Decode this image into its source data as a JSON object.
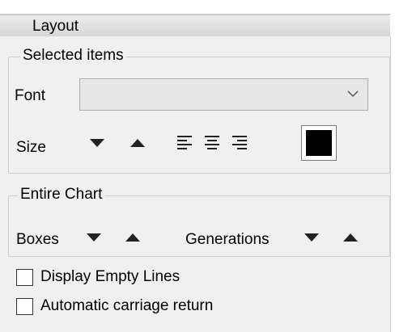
{
  "panel": {
    "title": "Layout"
  },
  "selected_items": {
    "title": "Selected items",
    "font_label": "Font",
    "font_value": "",
    "size_label": "Size",
    "color": "#000000"
  },
  "entire_chart": {
    "title": "Entire Chart",
    "boxes_label": "Boxes",
    "generations_label": "Generations",
    "display_empty_lines": {
      "label": "Display Empty Lines",
      "checked": false
    },
    "automatic_carriage_return": {
      "label": "Automatic carriage return",
      "checked": false
    }
  }
}
